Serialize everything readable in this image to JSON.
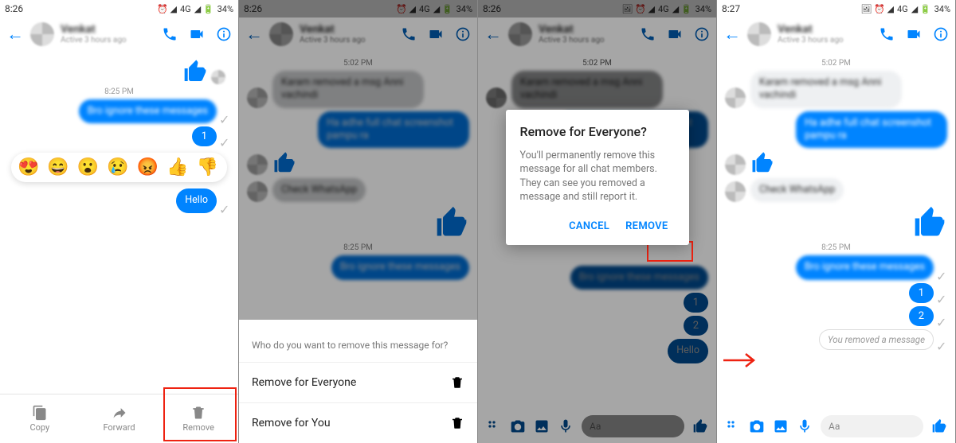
{
  "status": {
    "time1": "8:26",
    "time2": "8:26",
    "time3": "8:26",
    "time4": "8:27",
    "net": "4G",
    "batt": "34%"
  },
  "contact": {
    "name": "Venkat",
    "sub": "Active 3 hours ago"
  },
  "messages": {
    "ts1": "8:25 PM",
    "ts2": "5:02 PM",
    "m1": "Bro ignore these messages",
    "m2": "1",
    "m3": "2",
    "hello": "Hello",
    "in1": "Karam removed a msg Anni vachindi",
    "out2": "Ha adhe full chat screenshot pampu ra",
    "in3": "Check WhatsApp"
  },
  "bottombar": {
    "copy": "Copy",
    "forward": "Forward",
    "remove": "Remove"
  },
  "sheet": {
    "title": "Who do you want to remove this message for?",
    "opt1": "Remove for Everyone",
    "opt2": "Remove for You"
  },
  "dialog": {
    "title": "Remove for Everyone?",
    "body": "You'll permanently remove this message for all chat members. They can see you removed a message and still report it.",
    "cancel": "CANCEL",
    "remove": "REMOVE"
  },
  "removed": "You removed a message",
  "composer": {
    "placeholder": "Aa"
  }
}
